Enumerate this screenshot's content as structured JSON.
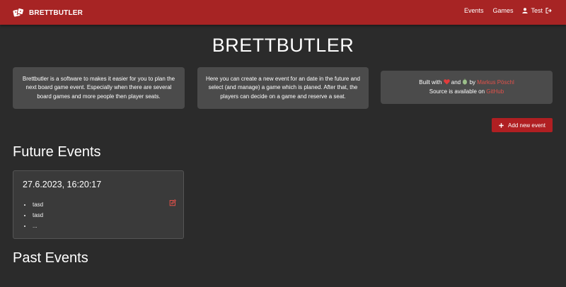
{
  "app": {
    "brand": "BRETTBUTLER",
    "nav": {
      "events": "Events",
      "games": "Games",
      "user": "Test"
    }
  },
  "hero": {
    "title": "BRETTBUTLER"
  },
  "info_cards": {
    "about": "Brettbutler is a software to makes it easier for you to plan the next board game event. Especially when there are several board games and more people then player seats.",
    "howto": "Here you can create a new event for an date in the future and select (and manage) a game which is planed. After that, the players can decide on a game and reserve a seat.",
    "credits": {
      "built_prefix": "Built with",
      "and": "and",
      "by": "by",
      "author": "Markus Pöschl",
      "source_prefix": "Source is available on",
      "source_link": "GitHub"
    }
  },
  "actions": {
    "add_event": "Add new event"
  },
  "future_events": {
    "title": "Future Events",
    "events": [
      {
        "date": "27.6.2023, 16:20:17",
        "games": [
          "tasd",
          "tasd",
          "..."
        ]
      }
    ]
  },
  "past_events": {
    "title": "Past Events"
  },
  "colors": {
    "navbar": "#a72424",
    "accent": "#e2514a",
    "button": "#b01f22",
    "background": "#2b2b2b",
    "card": "#4b4b4b"
  },
  "icons": {
    "brand": "dice-icon",
    "user": "user-icon",
    "logout": "logout-icon",
    "heart": "heart-icon",
    "coffee": "coffee-icon",
    "add": "plus-icon",
    "edit": "edit-icon"
  }
}
